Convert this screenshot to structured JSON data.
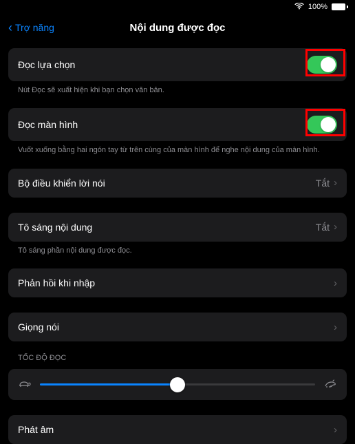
{
  "status": {
    "battery_pct": "100%"
  },
  "nav": {
    "back_label": "Trợ năng",
    "title": "Nội dung được đọc"
  },
  "rows": {
    "speak_selection": {
      "label": "Đọc lựa chọn",
      "footer": "Nút Đọc sẽ xuất hiện khi bạn chọn văn bản."
    },
    "speak_screen": {
      "label": "Đọc màn hình",
      "footer": "Vuốt xuống bằng hai ngón tay từ trên cùng của màn hình để nghe nội dung của màn hình."
    },
    "speech_controller": {
      "label": "Bộ điều khiển lời nói",
      "value": "Tắt"
    },
    "highlight_content": {
      "label": "Tô sáng nội dung",
      "value": "Tắt",
      "footer": "Tô sáng phần nội dung được đọc."
    },
    "typing_feedback": {
      "label": "Phản hồi khi nhập"
    },
    "voices": {
      "label": "Giọng nói"
    },
    "speaking_rate_header": "TỐC ĐỘ ĐỌC",
    "pronunciations": {
      "label": "Phát âm"
    }
  },
  "slider": {
    "value": 50
  }
}
